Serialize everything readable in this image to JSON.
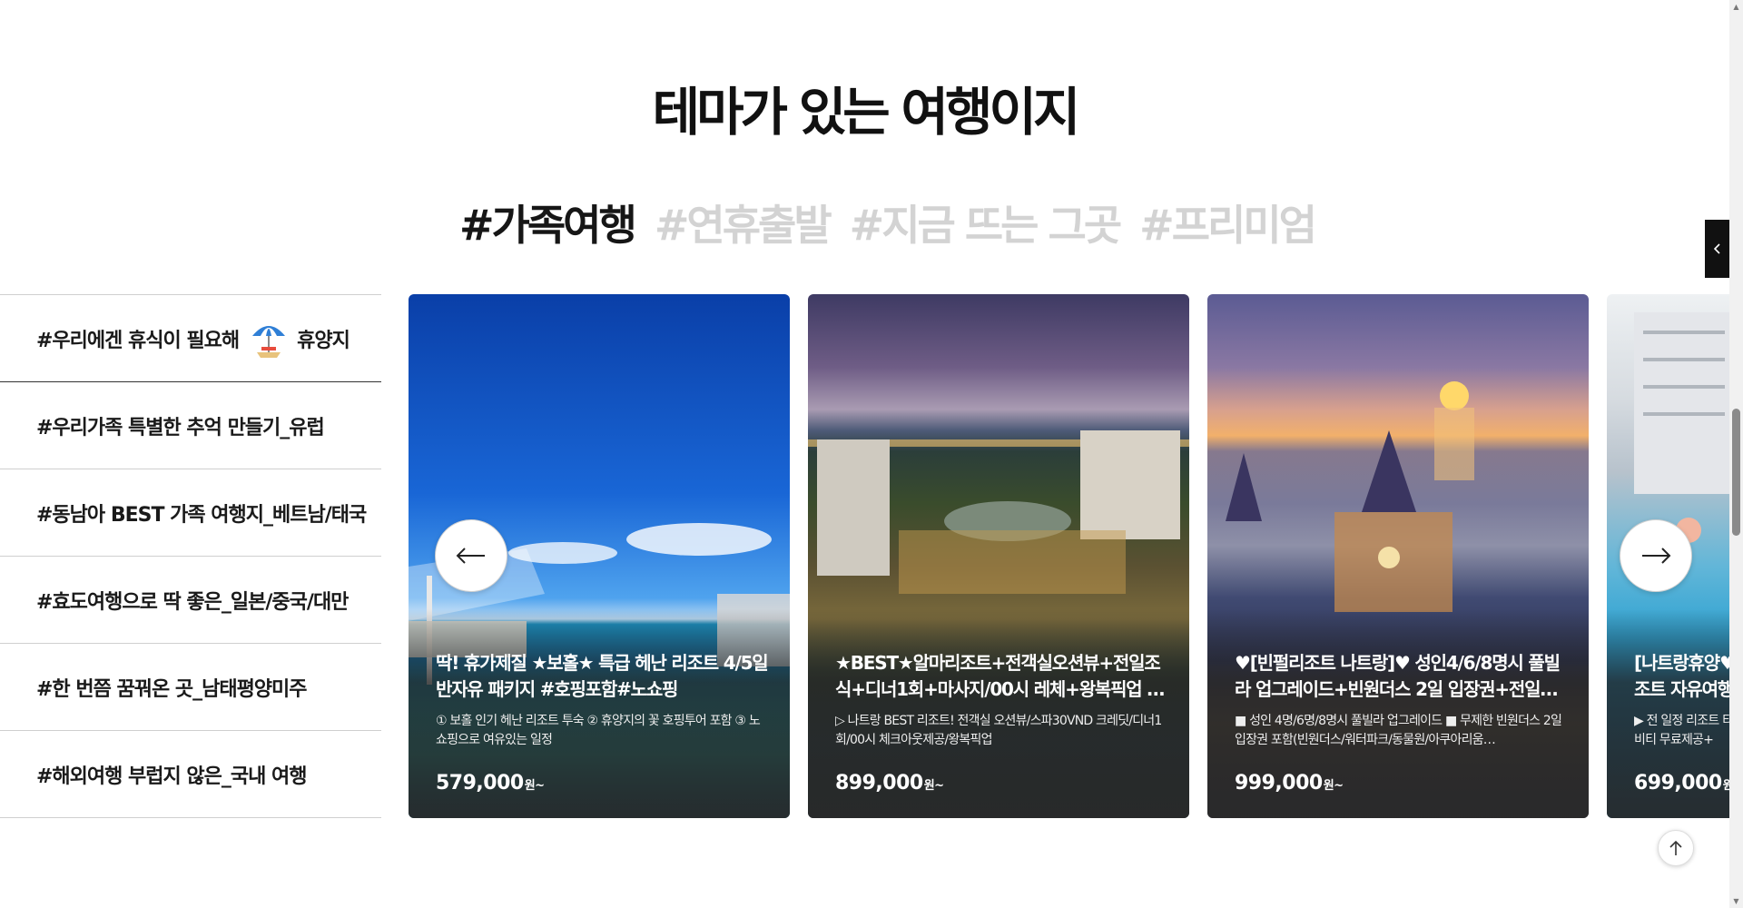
{
  "section_title": "테마가 있는 여행이지",
  "tabs": [
    {
      "label": "#가족여행",
      "active": true
    },
    {
      "label": "#연휴출발",
      "active": false
    },
    {
      "label": "#지금 뜨는 그곳",
      "active": false
    },
    {
      "label": "#프리미엄",
      "active": false
    }
  ],
  "menu": [
    {
      "label": "#우리에겐 휴식이 필요해",
      "suffix": "휴양지",
      "icon": "beach-umbrella-icon",
      "active": true
    },
    {
      "label": "#우리가족 특별한 추억 만들기_유럽"
    },
    {
      "label": "#동남아 BEST 가족 여행지_베트남/태국"
    },
    {
      "label": "#효도여행으로 딱 좋은_일본/중국/대만"
    },
    {
      "label": "#한 번쯤 꿈꿔온 곳_남태평양미주"
    },
    {
      "label": "#해외여행 부럽지 않은_국내 여행"
    }
  ],
  "cards": [
    {
      "title": "딱! 휴가제질 ★보홀★ 특급 헤난 리조트 4/5일 반자유 패키지 #호핑포함#노쇼핑",
      "desc": "① 보홀 인기 헤난 리조트 투숙 ② 휴양지의 꽃 호핑투어 포함 ③ 노쇼핑으로 여유있는 일정",
      "price": "579,000",
      "unit": "원~"
    },
    {
      "title": "★BEST★알마리조트+전객실오션뷰+전일조식+디너1회+마사지/00시 레체+왕복픽업 …",
      "desc": "▷ 나트랑 BEST 리조트! 전객실 오션뷰/스파30VND 크레딧/디너1회/00시 체크아웃제공/왕복픽업",
      "price": "899,000",
      "unit": "원~"
    },
    {
      "title": "♥[빈펄리조트 나트랑]♥ 성인4/6/8명시 풀빌라 업그레이드+빈원더스 2일 입장권+전일…",
      "desc": "■ 성인 4명/6명/8명시 풀빌라 업그레이드 ■ 무제한 빈원더스 2일 입장권 포함(빈원더스/워터파크/동물원/아쿠아리움…",
      "price": "999,000",
      "unit": "원~"
    },
    {
      "title": "[나트랑휴양♥ 조트 자유여행",
      "desc": "▶ 전 일정 리조트 티비티 무료제공+",
      "price": "699,000",
      "unit": "원~"
    }
  ],
  "controls": {
    "prev_icon": "arrow-left-icon",
    "next_icon": "arrow-right-icon",
    "side_toggle_icon": "chevron-left-icon",
    "top_icon": "arrow-up-icon"
  },
  "colors": {
    "title": "#111111",
    "tab_active": "#161616",
    "tab_inactive": "#d3d3d3",
    "side_toggle": "#111111"
  }
}
